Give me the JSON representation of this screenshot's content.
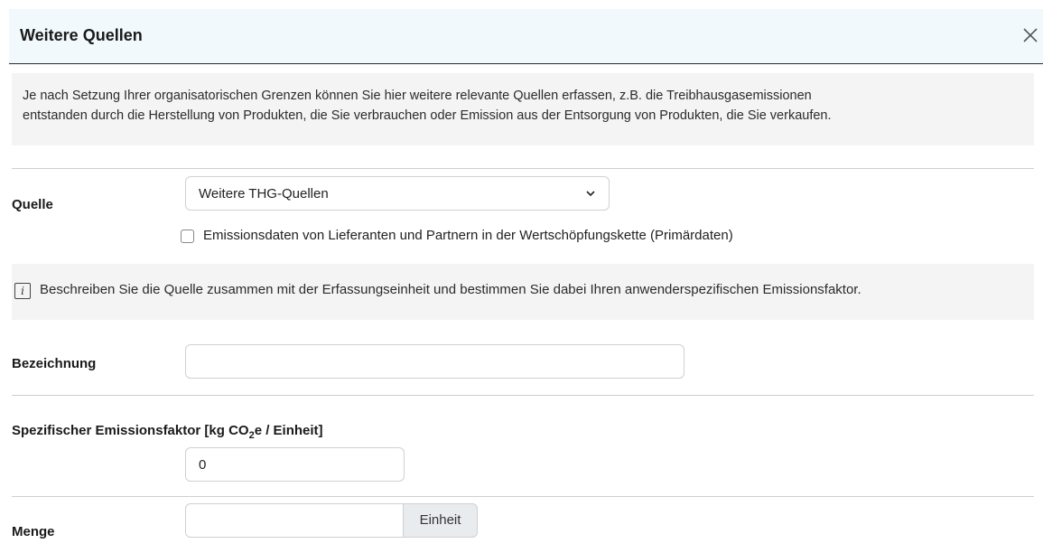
{
  "modal": {
    "title": "Weitere Quellen",
    "close_icon": "close-icon"
  },
  "intro": {
    "line1": "Je nach Setzung Ihrer organisatorischen Grenzen können Sie hier weitere relevante Quellen erfassen, z.B. die Treibhausgasemissionen",
    "line2": "entstanden durch die Herstellung von Produkten, die Sie verbrauchen oder Emission aus der Entsorgung von Produkten, die Sie verkaufen."
  },
  "quelle": {
    "label": "Quelle",
    "selected": "Weitere THG-Quellen"
  },
  "primary_data": {
    "label": "Emissionsdaten von Lieferanten und Partnern in der Wertschöpfungskette (Primärdaten)",
    "checked": false
  },
  "info": {
    "icon_glyph": "i",
    "text": "Beschreiben Sie die Quelle zusammen mit der Erfassungseinheit und bestimmen Sie dabei Ihren anwenderspezifischen Emissionsfaktor."
  },
  "bezeichnung": {
    "label": "Bezeichnung",
    "value": ""
  },
  "emissionsfaktor": {
    "label_prefix": "Spezifischer Emissionsfaktor [kg CO",
    "label_sub": "2",
    "label_suffix": "e / Einheit]",
    "value": "0"
  },
  "menge": {
    "label": "Menge",
    "value": "",
    "unit": "Einheit"
  },
  "colors": {
    "header_bg": "#f1f9fd",
    "panel_bg": "#f4f4f4",
    "addon_bg": "#e9ecef"
  }
}
